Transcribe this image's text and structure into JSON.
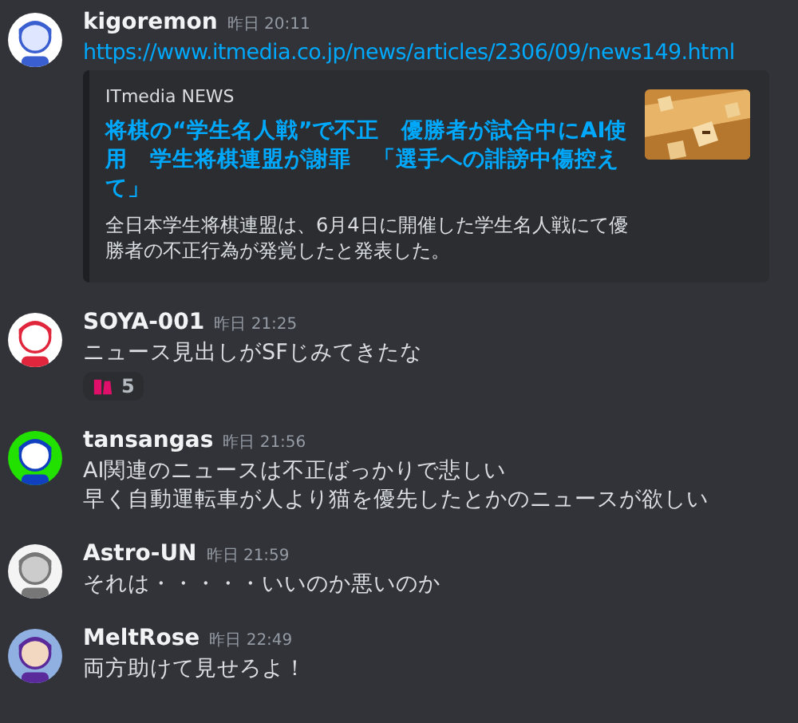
{
  "messages": [
    {
      "author": "kigoremon",
      "timestamp": "昨日 20:11",
      "avatar": {
        "kind": "picture"
      },
      "link": "https://www.itmedia.co.jp/news/articles/2306/09/news149.html",
      "embed": {
        "provider": "ITmedia NEWS",
        "title": "将棋の“学生名人戦”で不正　優勝者が試合中にAI使用　学生将棋連盟が謝罪　「選手への誹謗中傷控えて」",
        "description": "全日本学生将棋連盟は、6月4日に開催した学生名人戦にて優勝者の不正行為が発覚したと発表した。",
        "thumbnail": {
          "kind": "picture"
        }
      }
    },
    {
      "author": "SOYA-001",
      "timestamp": "昨日 21:25",
      "avatar": {
        "kind": "picture"
      },
      "lines": [
        "ニュース見出しがSFじみてきたな"
      ],
      "reactions": [
        {
          "count": "5"
        }
      ]
    },
    {
      "author": "tansangas",
      "timestamp": "昨日 21:56",
      "avatar": {
        "kind": "picture"
      },
      "lines": [
        "AI関連のニュースは不正ばっかりで悲しい",
        "早く自動運転車が人より猫を優先したとかのニュースが欲しい"
      ]
    },
    {
      "author": "Astro-UN",
      "timestamp": "昨日 21:59",
      "avatar": {
        "kind": "picture"
      },
      "lines": [
        "それは・・・・・いいのか悪いのか"
      ]
    },
    {
      "author": "MeltRose",
      "timestamp": "昨日 22:49",
      "avatar": {
        "kind": "picture"
      },
      "lines": [
        "両方助けて見せろよ！"
      ]
    }
  ]
}
